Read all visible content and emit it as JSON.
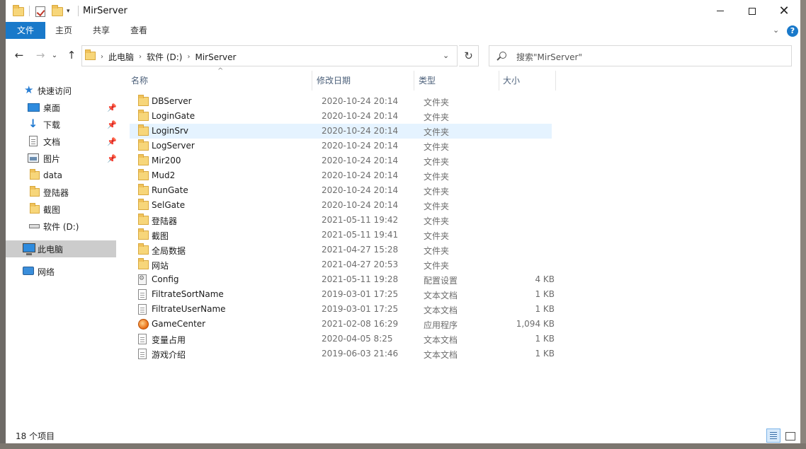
{
  "window": {
    "title": "MirServer",
    "controls": {
      "minimize": "",
      "maximize": "",
      "close": "✕"
    }
  },
  "ribbon": {
    "tabs": [
      "文件",
      "主页",
      "共享",
      "查看"
    ],
    "help": "?",
    "expand": "⌄"
  },
  "nav": {
    "back": "←",
    "forward": "→",
    "recent": "⌄",
    "up": "↑",
    "refresh": "↻",
    "breadcrumbs": [
      "此电脑",
      "软件 (D:)",
      "MirServer"
    ],
    "crumb_sep": "›",
    "dropdown": "⌄",
    "search_placeholder": "搜索\"MirServer\""
  },
  "sidebar": {
    "items": [
      {
        "label": "快速访问",
        "icon": "star-icon"
      },
      {
        "label": "桌面",
        "icon": "desktop-icon",
        "pinned": true
      },
      {
        "label": "下载",
        "icon": "download-icon",
        "pinned": true
      },
      {
        "label": "文档",
        "icon": "document-icon",
        "pinned": true
      },
      {
        "label": "图片",
        "icon": "picture-icon",
        "pinned": true
      },
      {
        "label": "data",
        "icon": "folder-icon"
      },
      {
        "label": "登陆器",
        "icon": "folder-icon"
      },
      {
        "label": "截图",
        "icon": "folder-icon"
      },
      {
        "label": "软件 (D:)",
        "icon": "drive-icon"
      },
      {
        "label": "此电脑",
        "icon": "computer-icon",
        "selected": true
      },
      {
        "label": "网络",
        "icon": "network-icon"
      }
    ],
    "pin_glyph": "📌"
  },
  "columns": {
    "name": "名称",
    "date": "修改日期",
    "type": "类型",
    "size": "大小",
    "sort_caret": "^"
  },
  "files": [
    {
      "name": "DBServer",
      "date": "2020-10-24 20:14",
      "type": "文件夹",
      "size": "",
      "icon": "folder"
    },
    {
      "name": "LoginGate",
      "date": "2020-10-24 20:14",
      "type": "文件夹",
      "size": "",
      "icon": "folder"
    },
    {
      "name": "LoginSrv",
      "date": "2020-10-24 20:14",
      "type": "文件夹",
      "size": "",
      "icon": "folder",
      "highlight": true
    },
    {
      "name": "LogServer",
      "date": "2020-10-24 20:14",
      "type": "文件夹",
      "size": "",
      "icon": "folder"
    },
    {
      "name": "Mir200",
      "date": "2020-10-24 20:14",
      "type": "文件夹",
      "size": "",
      "icon": "folder"
    },
    {
      "name": "Mud2",
      "date": "2020-10-24 20:14",
      "type": "文件夹",
      "size": "",
      "icon": "folder"
    },
    {
      "name": "RunGate",
      "date": "2020-10-24 20:14",
      "type": "文件夹",
      "size": "",
      "icon": "folder"
    },
    {
      "name": "SelGate",
      "date": "2020-10-24 20:14",
      "type": "文件夹",
      "size": "",
      "icon": "folder"
    },
    {
      "name": "登陆器",
      "date": "2021-05-11 19:42",
      "type": "文件夹",
      "size": "",
      "icon": "folder"
    },
    {
      "name": "截图",
      "date": "2021-05-11 19:41",
      "type": "文件夹",
      "size": "",
      "icon": "folder"
    },
    {
      "name": "全局数据",
      "date": "2021-04-27 15:28",
      "type": "文件夹",
      "size": "",
      "icon": "folder"
    },
    {
      "name": "网站",
      "date": "2021-04-27 20:53",
      "type": "文件夹",
      "size": "",
      "icon": "folder"
    },
    {
      "name": "Config",
      "date": "2021-05-11 19:28",
      "type": "配置设置",
      "size": "4 KB",
      "icon": "config"
    },
    {
      "name": "FiltrateSortName",
      "date": "2019-03-01 17:25",
      "type": "文本文档",
      "size": "1 KB",
      "icon": "text"
    },
    {
      "name": "FiltrateUserName",
      "date": "2019-03-01 17:25",
      "type": "文本文档",
      "size": "1 KB",
      "icon": "text"
    },
    {
      "name": "GameCenter",
      "date": "2021-02-08 16:29",
      "type": "应用程序",
      "size": "1,094 KB",
      "icon": "exe"
    },
    {
      "name": "变量占用",
      "date": "2020-04-05 8:25",
      "type": "文本文档",
      "size": "1 KB",
      "icon": "text"
    },
    {
      "name": "游戏介绍",
      "date": "2019-06-03 21:46",
      "type": "文本文档",
      "size": "1 KB",
      "icon": "text"
    }
  ],
  "status": {
    "count_text": "18 个项目"
  },
  "colors": {
    "accent": "#1979ca",
    "hover": "#e5f3ff",
    "selected_nav": "#cccccc"
  }
}
